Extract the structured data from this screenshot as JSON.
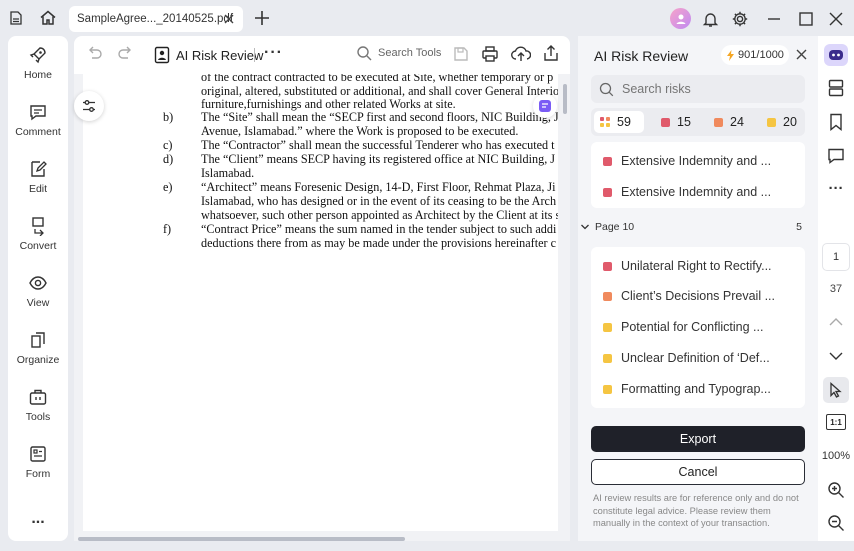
{
  "titlebar": {
    "tab_label": "SampleAgree..._20140525.pdf",
    "icons": [
      "home-icon",
      "close-icon",
      "plus-icon",
      "avatar",
      "bell-icon",
      "gear-icon",
      "minimize-icon",
      "maximize-icon",
      "close-window-icon"
    ]
  },
  "sidebar": {
    "items": [
      {
        "label": "Home",
        "icon": "rocket-icon"
      },
      {
        "label": "Comment",
        "icon": "comment-icon"
      },
      {
        "label": "Edit",
        "icon": "edit-icon"
      },
      {
        "label": "Convert",
        "icon": "convert-icon"
      },
      {
        "label": "View",
        "icon": "eye-icon"
      },
      {
        "label": "Organize",
        "icon": "organize-icon"
      },
      {
        "label": "Tools",
        "icon": "toolbox-icon"
      },
      {
        "label": "Form",
        "icon": "form-icon"
      }
    ],
    "more": "..."
  },
  "toolbar": {
    "ai_risk_label": "AI Risk Review",
    "search_label": "Search Tools"
  },
  "document": {
    "lines": [
      {
        "num": "",
        "text": "of the contract contracted to be executed at Site, whether temporary or p"
      },
      {
        "num": "",
        "text": "original, altered, substituted or additional, and shall cover General Interio"
      },
      {
        "num": "",
        "text": "furniture,furnishings and other related Works at site."
      },
      {
        "num": "b)",
        "text": "The “Site” shall mean the “SECP first and second floors, NIC Building, J"
      },
      {
        "num": "",
        "text": "Avenue, Islamabad.” where the Work is proposed to be executed."
      },
      {
        "num": "c)",
        "text": "The “Contractor” shall mean the successful Tenderer who has executed t"
      },
      {
        "num": "d)",
        "text": "The “Client” means SECP having its registered office at NIC Building, J"
      },
      {
        "num": "",
        "text": "Islamabad."
      },
      {
        "num": "e)",
        "text": "“Architect” means Foresenic Design, 14-D, First Floor, Rehmat Plaza, Ji"
      },
      {
        "num": "",
        "text": "Islamabad, who has designed or in the event of its ceasing to be the Arch"
      },
      {
        "num": "",
        "text": "whatsoever, such other person appointed as Architect by the Client at its s"
      },
      {
        "num": "f)",
        "text": "“Contract Price” means the sum named in the tender subject to such addi"
      },
      {
        "num": "",
        "text": "deductions there from as may be made under the provisions hereinafter c"
      }
    ]
  },
  "panel": {
    "title": "AI Risk Review",
    "credits": "901/1000",
    "search_placeholder": "Search risks",
    "filters": [
      {
        "label": "59",
        "color": "#multi",
        "active": true
      },
      {
        "label": "15",
        "color": "#e05a6b"
      },
      {
        "label": "24",
        "color": "#f08a5d"
      },
      {
        "label": "20",
        "color": "#f5c542"
      }
    ],
    "group1": [
      {
        "text": "Extensive Indemnity and ...",
        "color": "#e05a6b"
      },
      {
        "text": "Extensive Indemnity and ...",
        "color": "#e05a6b"
      }
    ],
    "page_group": {
      "label": "Page 10",
      "count": "5"
    },
    "group2": [
      {
        "text": "Unilateral Right to Rectify...",
        "color": "#e05a6b"
      },
      {
        "text": "Client’s Decisions Prevail ...",
        "color": "#f08a5d"
      },
      {
        "text": "Potential for Conflicting ...",
        "color": "#f5c542"
      },
      {
        "text": "Unclear Definition of ‘Def...",
        "color": "#f5c542"
      },
      {
        "text": "Formatting and Typograp...",
        "color": "#f5c542"
      }
    ],
    "export_label": "Export",
    "cancel_label": "Cancel",
    "disclaimer": "AI review results are for reference only and do not constitute legal advice. Please review them manually in the context of your transaction."
  },
  "rightrail": {
    "page_current": "1",
    "page_total": "37",
    "zoom": "100%",
    "fit_label": "1:1"
  }
}
